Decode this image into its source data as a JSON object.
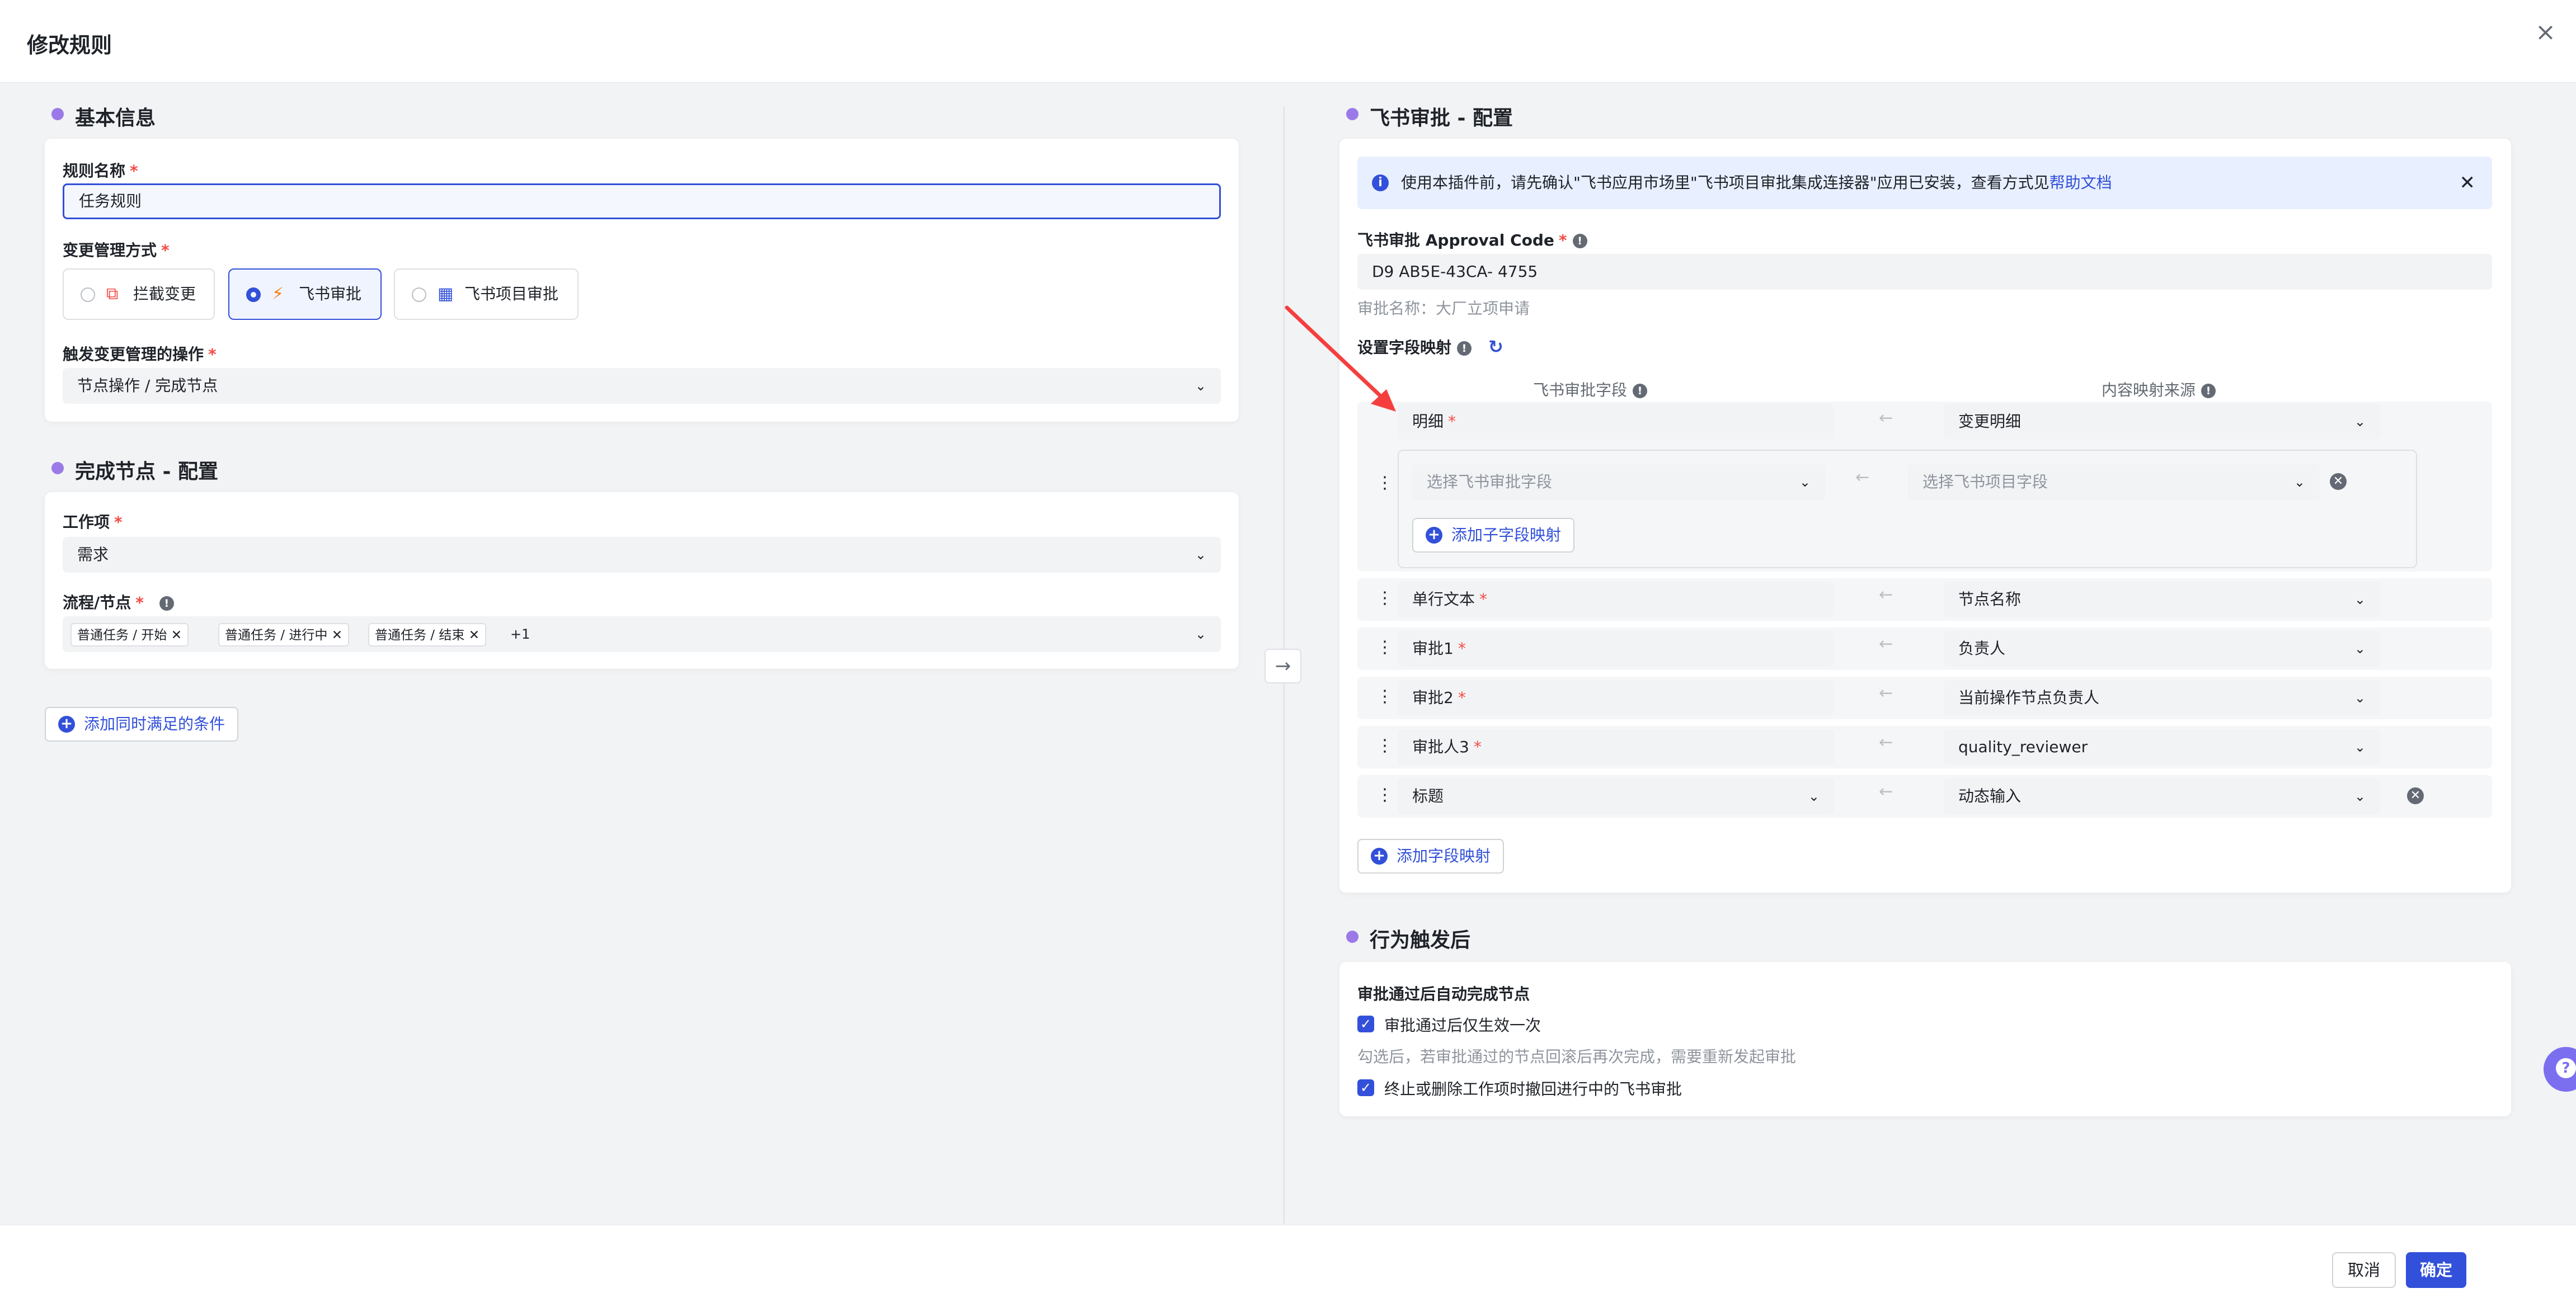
{
  "header": {
    "title": "修改规则",
    "close": "×"
  },
  "basic": {
    "section_title": "基本信息",
    "rule_name_label": "规则名称",
    "rule_name_value": "任务规则",
    "change_mode_label": "变更管理方式",
    "options": [
      "拦截变更",
      "飞书审批",
      "飞书项目审批"
    ],
    "selected_option": "飞书审批",
    "trigger_label": "触发变更管理的操作",
    "trigger_value": "节点操作 / 完成节点"
  },
  "complete_node": {
    "section_title": "完成节点 - 配置",
    "work_item_label": "工作项",
    "work_item_value": "需求",
    "flow_label": "流程/节点",
    "tags": [
      "普通任务 / 开始",
      "普通任务 / 进行中",
      "普通任务 / 结束"
    ],
    "more": "+1"
  },
  "add_condition": "添加同时满足的条件",
  "approval": {
    "section_title": "飞书审批 - 配置",
    "banner_text": "使用本插件前，请先确认\"飞书应用市场里\"飞书项目审批集成连接器\"应用已安装，查看方式见",
    "banner_link": "帮助文档",
    "approval_code_label": "飞书审批 Approval Code",
    "approval_code_value": "D9        AB5E-43CA-                 4755",
    "approval_name": "审批名称：大厂立项申请",
    "mapping_label": "设置字段映射",
    "col_field": "飞书审批字段",
    "col_source": "内容映射来源",
    "rows": [
      {
        "field": "明细",
        "required": true,
        "source": "变更明细"
      },
      {
        "field": "单行文本",
        "required": true,
        "source": "节点名称"
      },
      {
        "field": "审批1",
        "required": true,
        "source": "负责人"
      },
      {
        "field": "审批2",
        "required": true,
        "source": "当前操作节点负责人"
      },
      {
        "field": "审批人3",
        "required": true,
        "source": "quality_reviewer"
      },
      {
        "field": "标题",
        "required": false,
        "source": "动态输入"
      }
    ],
    "sub_field_placeholder": "选择飞书审批字段",
    "sub_source_placeholder": "选择飞书项目字段",
    "add_sub_mapping": "添加子字段映射",
    "add_mapping": "添加字段映射"
  },
  "after": {
    "section_title": "行为触发后",
    "auto_complete_label": "审批通过后自动完成节点",
    "check1": "审批通过后仅生效一次",
    "hint": "勾选后，若审批通过的节点回滚后再次完成，需要重新发起审批",
    "check2": "终止或删除工作项时撤回进行中的飞书审批"
  },
  "footer": {
    "cancel": "取消",
    "ok": "确定"
  },
  "icons": {
    "accent": "#3250d9",
    "purple": "#9b7ae8",
    "required": "#f54a45"
  }
}
